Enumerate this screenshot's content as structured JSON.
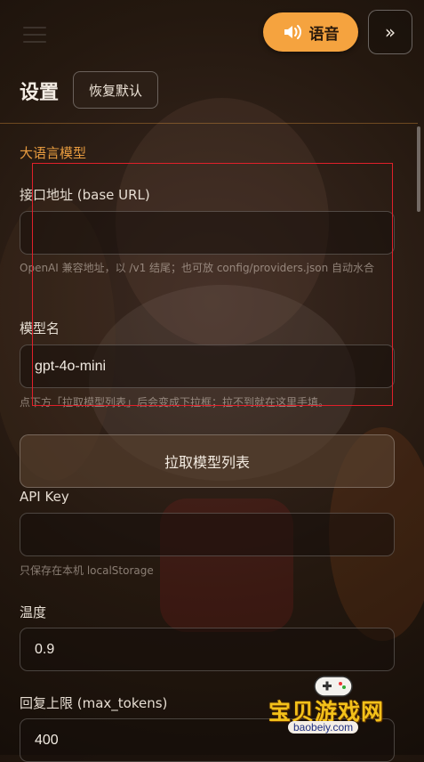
{
  "header": {
    "voice_label": "语音",
    "expand_label": "»"
  },
  "settings": {
    "title": "设置",
    "reset_label": "恢复默认",
    "section_title": "大语言模型"
  },
  "fields": {
    "base_url": {
      "label": "接口地址 (base URL)",
      "value": "",
      "hint": "OpenAI 兼容地址，以 /v1 结尾；也可放 config/providers.json 自动水合"
    },
    "model": {
      "label": "模型名",
      "value": "gpt-4o-mini",
      "hint": "点下方「拉取模型列表」后会变成下拉框；拉不到就在这里手填。"
    },
    "fetch_models_label": "拉取模型列表",
    "api_key": {
      "label": "API Key",
      "value": "",
      "hint": "只保存在本机 localStorage"
    },
    "temperature": {
      "label": "温度",
      "value": "0.9"
    },
    "max_tokens": {
      "label": "回复上限 (max_tokens)",
      "value": "400"
    }
  },
  "watermark": {
    "text": "宝贝游戏网",
    "url": "baobeiy.com"
  },
  "colors": {
    "accent": "#f5a33f",
    "section": "#e79b3f",
    "highlight": "#e0202a"
  }
}
